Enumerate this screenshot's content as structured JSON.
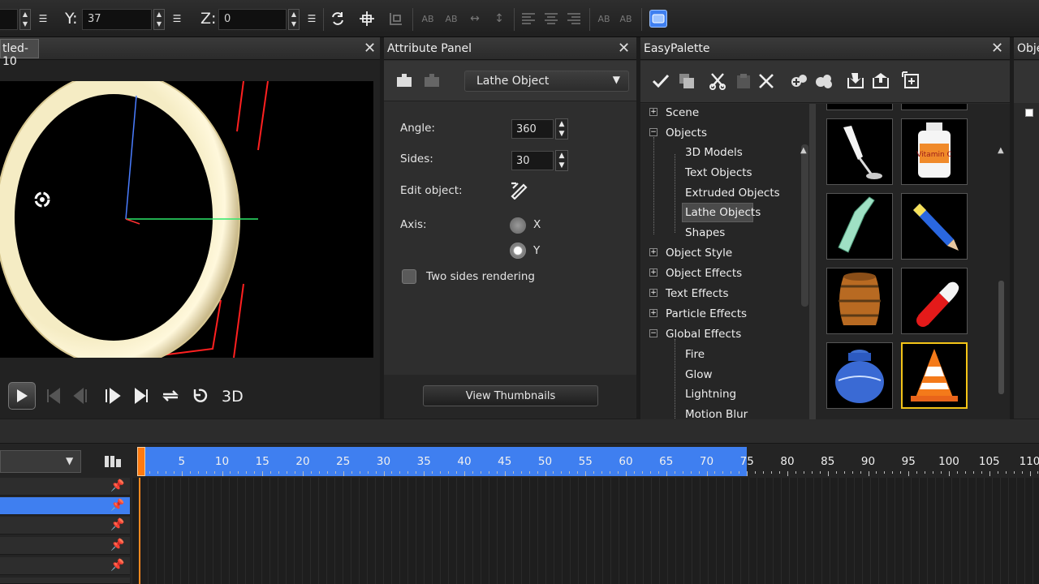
{
  "toolbar": {
    "y_label": "Y:",
    "y_value": "37",
    "z_label": "Z:",
    "z_value": "0",
    "text_tools": [
      "AB",
      "AB",
      "AB",
      "AB",
      "AB",
      "AB"
    ]
  },
  "preview": {
    "tab_title": "tled-10",
    "close": "✕",
    "playback_3d": "3D"
  },
  "attribute_panel": {
    "title": "Attribute Panel",
    "close": "✕",
    "object_type": "Lathe Object",
    "angle_label": "Angle:",
    "angle_value": "360",
    "sides_label": "Sides:",
    "sides_value": "30",
    "edit_label": "Edit object:",
    "axis_label": "Axis:",
    "axis_x": "X",
    "axis_y": "Y",
    "axis_selected": "Y",
    "two_sides_label": "Two sides rendering",
    "view_thumbs": "View Thumbnails"
  },
  "palette": {
    "title": "EasyPalette",
    "close": "✕",
    "tree": [
      {
        "label": "Scene",
        "level": 0,
        "expander": "+"
      },
      {
        "label": "Objects",
        "level": 0,
        "expander": "−"
      },
      {
        "label": "3D Models",
        "level": 1
      },
      {
        "label": "Text Objects",
        "level": 1
      },
      {
        "label": "Extruded Objects",
        "level": 1
      },
      {
        "label": "Lathe Objects",
        "level": 1,
        "selected": true
      },
      {
        "label": "Shapes",
        "level": 1
      },
      {
        "label": "Object Style",
        "level": 0,
        "expander": "+"
      },
      {
        "label": "Object Effects",
        "level": 0,
        "expander": "+"
      },
      {
        "label": "Text Effects",
        "level": 0,
        "expander": "+"
      },
      {
        "label": "Particle Effects",
        "level": 0,
        "expander": "+"
      },
      {
        "label": "Global Effects",
        "level": 0,
        "expander": "−"
      },
      {
        "label": "Fire",
        "level": 1
      },
      {
        "label": "Glow",
        "level": 1
      },
      {
        "label": "Lightning",
        "level": 1
      },
      {
        "label": "Motion Blur",
        "level": 1
      }
    ],
    "thumbnails": [
      {
        "name": "wine-glass",
        "selected": false
      },
      {
        "name": "vitamin-c-bottle",
        "selected": false
      },
      {
        "name": "green-bottle",
        "selected": false
      },
      {
        "name": "pencil",
        "selected": false
      },
      {
        "name": "wooden-barrel",
        "selected": false
      },
      {
        "name": "capsule-pill",
        "selected": false
      },
      {
        "name": "blue-jar",
        "selected": false
      },
      {
        "name": "traffic-cone",
        "selected": true
      }
    ],
    "bottle_label": "Vitamin C"
  },
  "objects_panel": {
    "title": "Obje"
  },
  "timeline": {
    "ticks": [
      "5",
      "10",
      "15",
      "20",
      "25",
      "30",
      "35",
      "40",
      "45",
      "50",
      "55",
      "60",
      "65",
      "70",
      "75",
      "80",
      "85",
      "90",
      "95",
      "100",
      "105",
      "110"
    ],
    "range_end_frame": 75,
    "current_frame": 0
  },
  "colors": {
    "accent_blue": "#3f7ff0",
    "selection_orange": "#ff7a10",
    "selected_thumb_border": "#f3c417"
  }
}
